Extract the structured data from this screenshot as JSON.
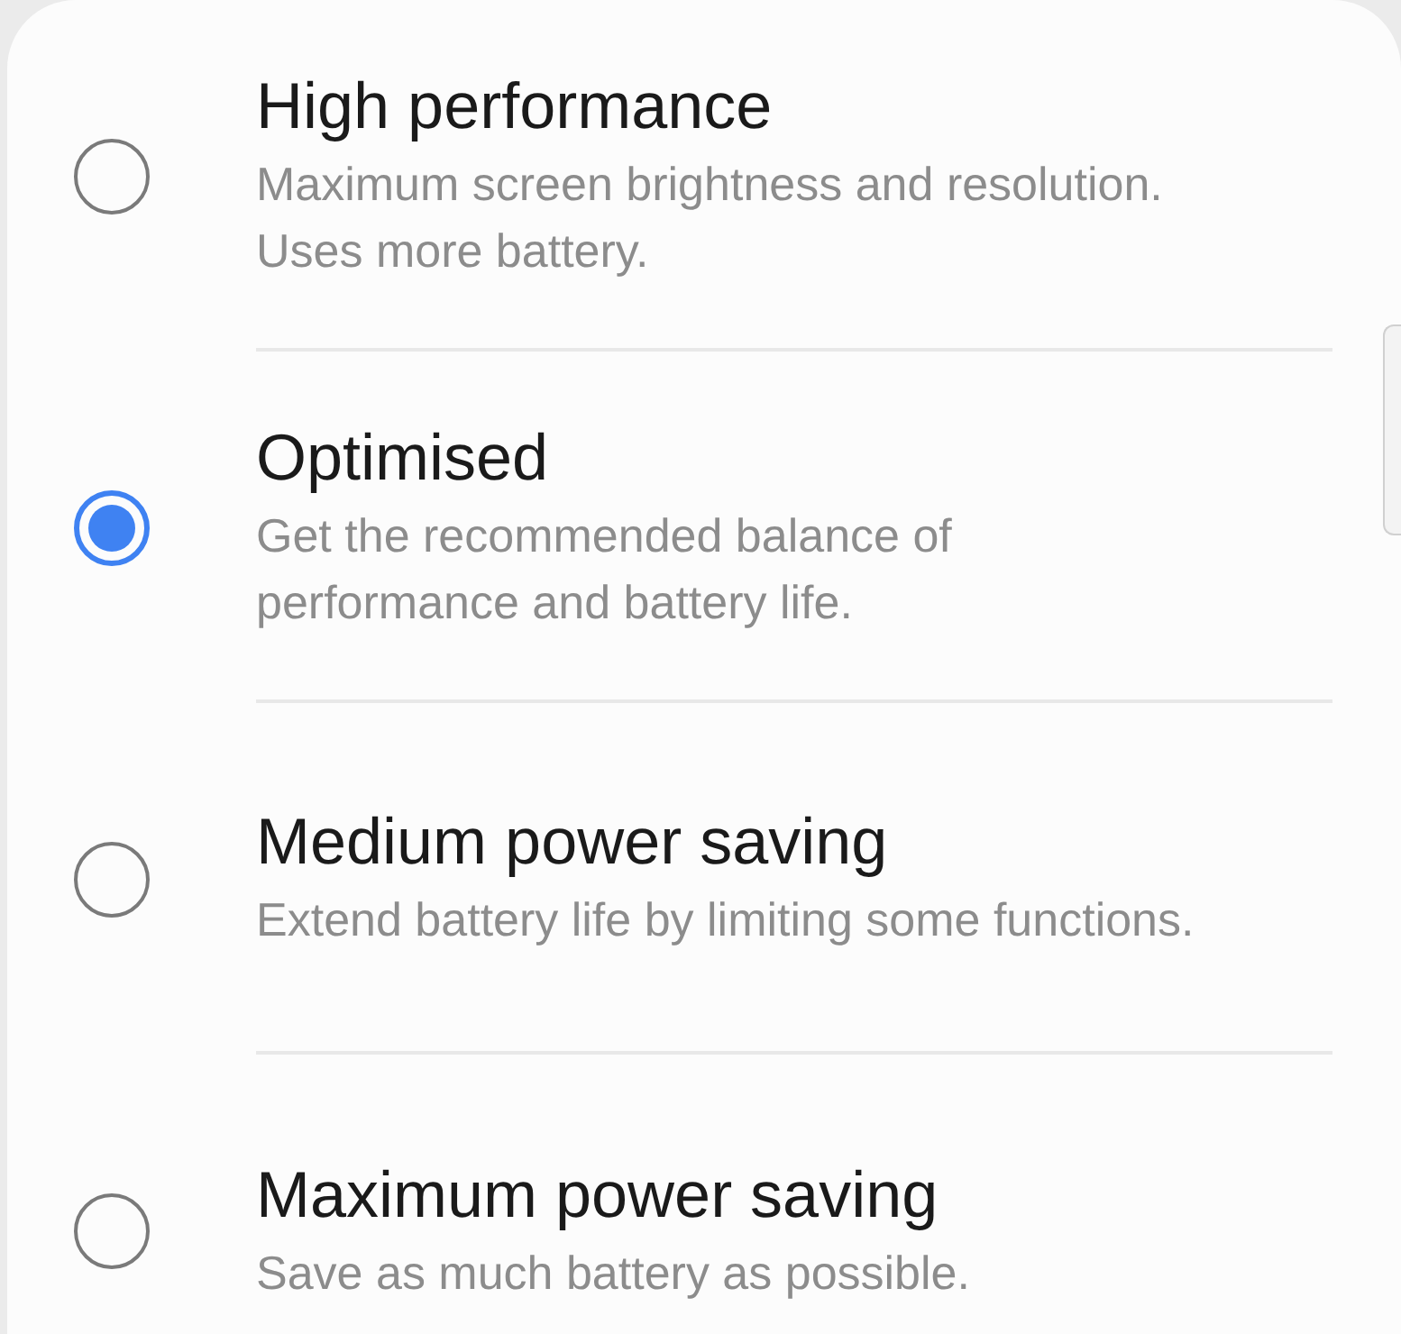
{
  "options": [
    {
      "title": "High performance",
      "description": "Maximum screen brightness and resolution. Uses more battery.",
      "selected": false
    },
    {
      "title": "Optimised",
      "description": "Get the recommended balance of performance and battery life.",
      "selected": true
    },
    {
      "title": "Medium power saving",
      "description": "Extend battery life by limiting some functions.",
      "selected": false
    },
    {
      "title": "Maximum power saving",
      "description": "Save as much battery as possible.",
      "selected": false
    }
  ]
}
